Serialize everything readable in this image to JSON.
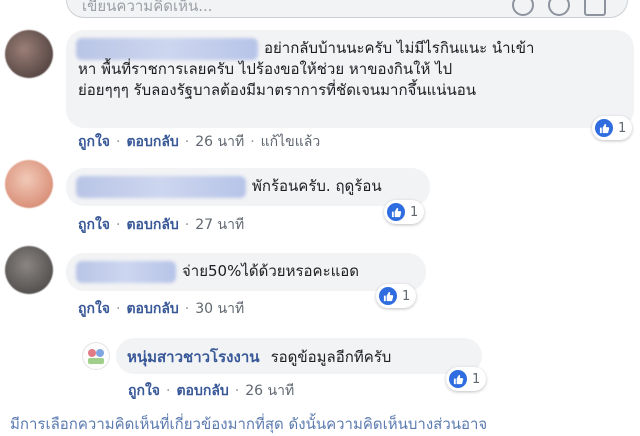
{
  "composer": {
    "placeholder": "เขียนความคิดเห็น..."
  },
  "comments": [
    {
      "text_lines": [
        "อย่ากลับบ้านนะครับ ไม่มีไรกินแนะ นำเข้า",
        "หา พื้นที่ราชการเลยครับ ไปร้องขอให้ช่วย หาของกินให้ ไป",
        "ย่อยๆๆๆ รับลองรัฐบาลต้องมีมาตราการที่ชัดเจนมากจึ้นแน่นอน"
      ],
      "like": "ถูกใจ",
      "reply": "ตอบกลับ",
      "time": "26 นาที",
      "edited": "แก้ไขแล้ว",
      "reactions": "1"
    },
    {
      "text": "พักร้อนครับ. ฤดูร้อน",
      "like": "ถูกใจ",
      "reply": "ตอบกลับ",
      "time": "27 นาที",
      "reactions": "1"
    },
    {
      "text": "จ่าย50%ได้ด้วยหรอคะแอด",
      "like": "ถูกใจ",
      "reply": "ตอบกลับ",
      "time": "30 นาที",
      "reactions": "1"
    }
  ],
  "reply": {
    "author": "หนุ่มสาวชาวโรงงาน",
    "text": "รอดูข้อมูลอีกทีครับ",
    "like": "ถูกใจ",
    "reply": "ตอบกลับ",
    "time": "26 นาที",
    "reactions": "1"
  },
  "footer_text": "มีการเลือกความคิดเห็นที่เกี่ยวข้องมากที่สุด ดังนั้นความคิดเห็นบางส่วนอาจ",
  "colors": {
    "link": "#385898",
    "like_blue": "#2e6ce0",
    "bubble": "#f2f3f5"
  }
}
